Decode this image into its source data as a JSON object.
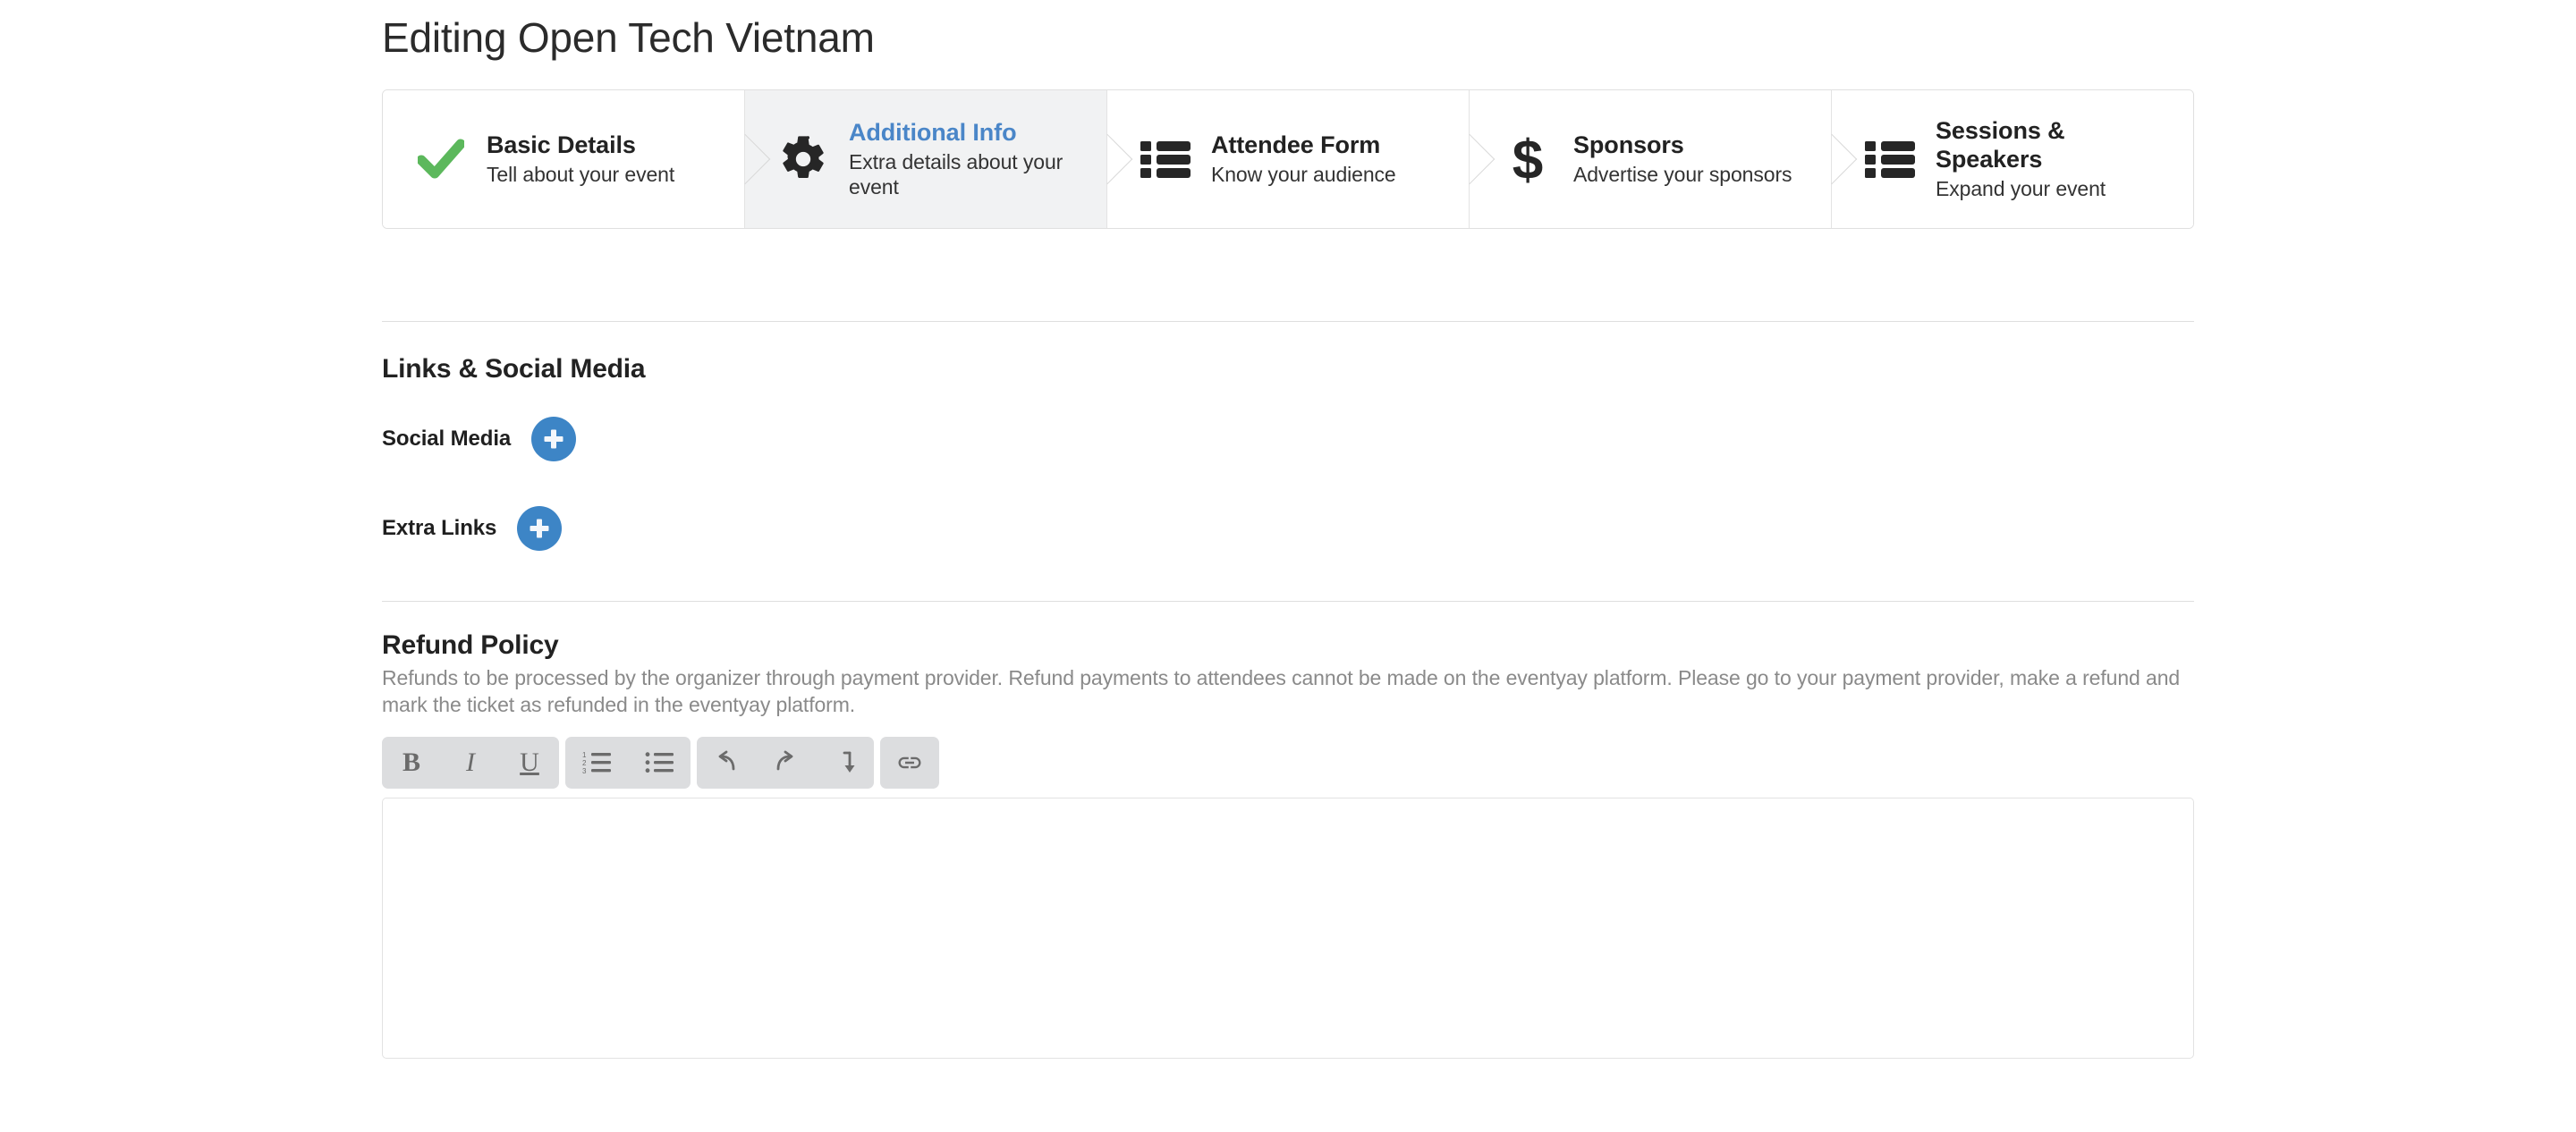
{
  "page": {
    "title": "Editing Open Tech Vietnam"
  },
  "wizard": {
    "steps": [
      {
        "icon": "check-icon",
        "title": "Basic Details",
        "subtitle": "Tell about your event",
        "state": "complete"
      },
      {
        "icon": "gear-icon",
        "title": "Additional Info",
        "subtitle": "Extra details about your event",
        "state": "active"
      },
      {
        "icon": "list-icon",
        "title": "Attendee Form",
        "subtitle": "Know your audience",
        "state": "default"
      },
      {
        "icon": "dollar-icon",
        "title": "Sponsors",
        "subtitle": "Advertise your sponsors",
        "state": "default"
      },
      {
        "icon": "list-icon",
        "title": "Sessions & Speakers",
        "subtitle": "Expand your event",
        "state": "default"
      }
    ]
  },
  "links_section": {
    "heading": "Links & Social Media",
    "social_media": {
      "label": "Social Media",
      "add_button_icon": "plus-icon"
    },
    "extra_links": {
      "label": "Extra Links",
      "add_button_icon": "plus-icon"
    }
  },
  "refund_policy": {
    "heading": "Refund Policy",
    "description": "Refunds to be processed by the organizer through payment provider. Refund payments to attendees cannot be made on the eventyay platform. Please go to your payment provider, make a refund and mark the ticket as refunded in the eventyay platform.",
    "editor": {
      "value": "",
      "placeholder": "",
      "toolbar": [
        {
          "group": 1,
          "name": "bold-button",
          "icon": "bold-icon",
          "label": "B"
        },
        {
          "group": 1,
          "name": "italic-button",
          "icon": "italic-icon",
          "label": "I"
        },
        {
          "group": 1,
          "name": "underline-button",
          "icon": "underline-icon",
          "label": "U"
        },
        {
          "group": 2,
          "name": "ordered-list-button",
          "icon": "ordered-list-icon",
          "label": ""
        },
        {
          "group": 2,
          "name": "bullet-list-button",
          "icon": "bullet-list-icon",
          "label": ""
        },
        {
          "group": 3,
          "name": "undo-button",
          "icon": "undo-icon",
          "label": ""
        },
        {
          "group": 3,
          "name": "redo-button",
          "icon": "redo-icon",
          "label": ""
        },
        {
          "group": 3,
          "name": "indent-button",
          "icon": "arrow-down-indent-icon",
          "label": ""
        },
        {
          "group": 4,
          "name": "link-button",
          "icon": "link-icon",
          "label": ""
        }
      ]
    }
  },
  "colors": {
    "accent_blue": "#4a86c8",
    "button_blue": "#3d85c6",
    "check_green": "#5cb85c",
    "icon_dark": "#262626",
    "muted_text": "#8a8a8a",
    "toolbar_gray": "#dcdddf",
    "border_gray": "#e0e0e0"
  }
}
